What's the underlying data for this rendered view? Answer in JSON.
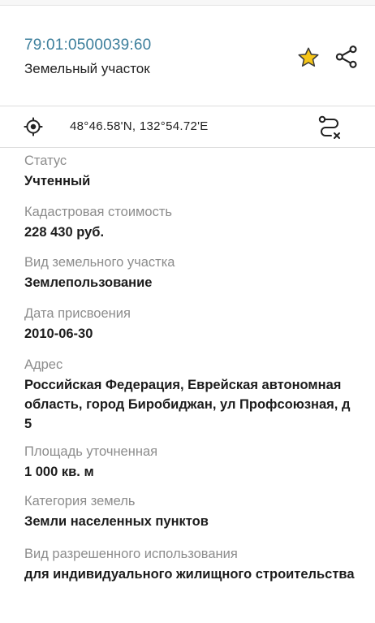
{
  "header": {
    "cadastral_number": "79:01:0500039:60",
    "object_type": "Земельный участок",
    "favorite_icon": "star-icon",
    "share_icon": "share-icon",
    "star_color": "#f5c518"
  },
  "coordinates": {
    "text": "48°46.58'N, 132°54.72'E",
    "locate_icon": "crosshair-icon",
    "route_icon": "route-icon"
  },
  "fields": {
    "status": {
      "label": "Статус",
      "value": "Учтенный"
    },
    "cost": {
      "label": "Кадастровая стоимость",
      "value": "228 430 руб."
    },
    "kind": {
      "label": "Вид земельного участка",
      "value": "Землепользование"
    },
    "date": {
      "label": "Дата присвоения",
      "value": "2010-06-30"
    },
    "address": {
      "label": "Адрес",
      "value": "Российская Федерация, Еврейская автономная область, город Биробиджан, ул Профсоюзная, д 5"
    },
    "area": {
      "label": "Площадь уточненная",
      "value": "1 000 кв. м"
    },
    "category": {
      "label": "Категория земель",
      "value": "Земли населенных пунктов"
    },
    "usage": {
      "label": "Вид разрешенного использования",
      "value": "для индивидуального жилищного строительства"
    }
  }
}
